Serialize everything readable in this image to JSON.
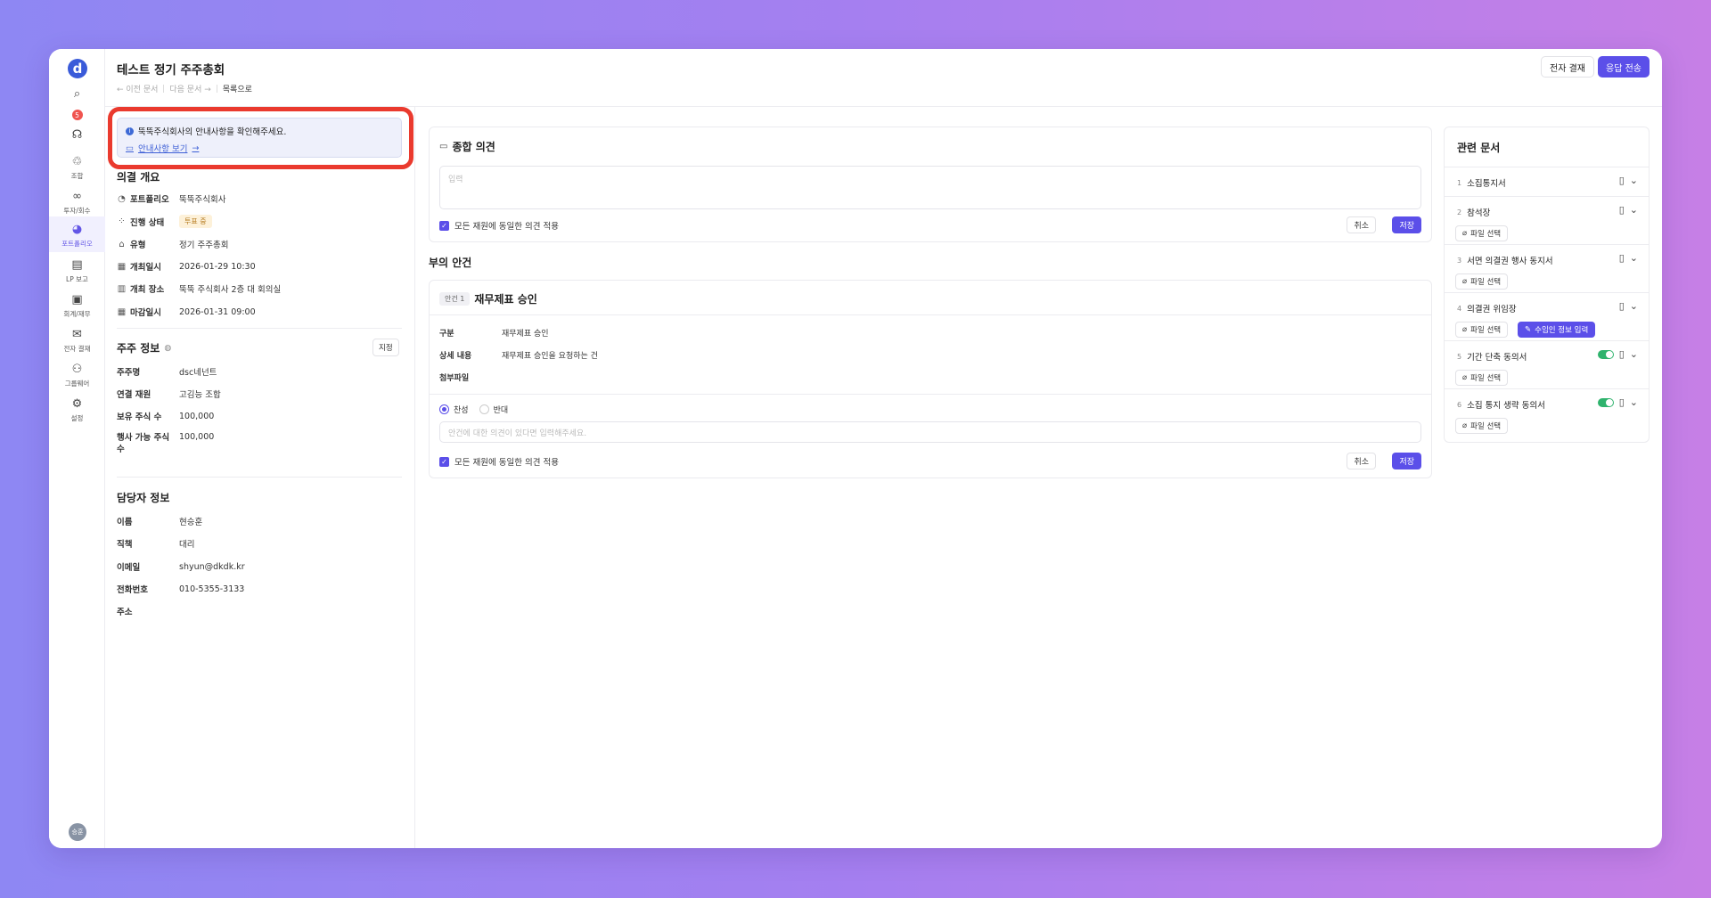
{
  "header": {
    "title": "테스트 정기 주주총회",
    "prev_doc": "← 이전 문서",
    "next_doc": "다음 문서 →",
    "to_list": "목록으로",
    "esign_label": "전자 결재",
    "send_label": "응답 전송"
  },
  "sidebar": {
    "logo": "d",
    "notification_count": "5",
    "items": [
      {
        "label": "조합",
        "icon": "association-icon"
      },
      {
        "label": "투자/회수",
        "icon": "investment-icon"
      },
      {
        "label": "포트폴리오",
        "icon": "portfolio-icon"
      },
      {
        "label": "LP 보고",
        "icon": "report-icon"
      },
      {
        "label": "회계/재무",
        "icon": "accounting-icon"
      },
      {
        "label": "전자 결재",
        "icon": "esign-icon"
      },
      {
        "label": "그룹웨어",
        "icon": "groupware-icon"
      },
      {
        "label": "설정",
        "icon": "settings-icon"
      }
    ],
    "avatar": "승훈"
  },
  "notice": {
    "text": "뚝뚝주식회사의 안내사항을 확인해주세요.",
    "link": "안내사항 보기"
  },
  "overview": {
    "title": "의결 개요",
    "rows": [
      {
        "label": "포트폴리오",
        "value": "뚝뚝주식회사"
      },
      {
        "label": "진행 상태",
        "value": "투표 중"
      },
      {
        "label": "유형",
        "value": "정기 주주총회"
      },
      {
        "label": "개최일시",
        "value": "2026-01-29 10:30"
      },
      {
        "label": "개최 장소",
        "value": "뚝뚝 주식회사 2층 대 회의실"
      },
      {
        "label": "마감일시",
        "value": "2026-01-31 09:00"
      }
    ]
  },
  "shareholder": {
    "title": "주주 정보",
    "assign_label": "지정",
    "rows": [
      {
        "label": "주주명",
        "value": "dsc네넌트"
      },
      {
        "label": "연결 재원",
        "value": "고김능 조합"
      },
      {
        "label": "보유 주식 수",
        "value": "100,000"
      },
      {
        "label": "행사 가능 주식 수",
        "value": "100,000"
      }
    ]
  },
  "manager": {
    "title": "담당자 정보",
    "rows": [
      {
        "label": "이름",
        "value": "현승훈"
      },
      {
        "label": "직책",
        "value": "대리"
      },
      {
        "label": "이메일",
        "value": "shyun@dkdk.kr"
      },
      {
        "label": "전화번호",
        "value": "010-5355-3133"
      },
      {
        "label": "주소",
        "value": ""
      }
    ]
  },
  "opinion": {
    "title": "종합 의견",
    "placeholder": "입력",
    "apply_all": "모든 재원에 동일한 의견 적용",
    "cancel": "취소",
    "save": "저장"
  },
  "agenda_section": {
    "title": "부의 안건",
    "chip": "안건 1",
    "name": "재무제표 승인",
    "rows": [
      {
        "label": "구분",
        "value": "재무제표 승인"
      },
      {
        "label": "상세 내용",
        "value": "재무제표 승인을 요청하는 건"
      },
      {
        "label": "첨부파일",
        "value": ""
      }
    ],
    "approve": "찬성",
    "reject": "반대",
    "input_placeholder": "안건에 대한 의견이 있다면 입력해주세요.",
    "apply_all": "모든 재원에 동일한 의견 적용",
    "cancel": "취소",
    "save": "저장"
  },
  "related": {
    "title": "관련 문서",
    "file_label": "파일 선택",
    "proxy_label": "수임인 정보 입력",
    "docs": [
      {
        "num": "1",
        "name": "소집통지서",
        "toggle": false,
        "has_file": false
      },
      {
        "num": "2",
        "name": "참석장",
        "toggle": false,
        "has_file": true
      },
      {
        "num": "3",
        "name": "서면 의결권 행사 동지서",
        "toggle": false,
        "has_file": true
      },
      {
        "num": "4",
        "name": "의결권 위임장",
        "toggle": false,
        "has_file": true
      },
      {
        "num": "5",
        "name": "기간 단축 동의서",
        "toggle": true,
        "has_file": true
      },
      {
        "num": "6",
        "name": "소집 통지 생략 동의서",
        "toggle": true,
        "has_file": true
      }
    ]
  },
  "colors": {
    "accent": "#5b4fe9",
    "highlight": "#ea3a2e",
    "toggle": "#2fb36d"
  }
}
